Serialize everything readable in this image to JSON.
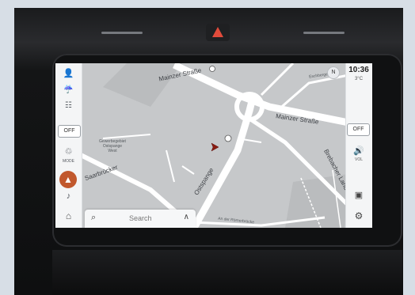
{
  "map": {
    "streets": {
      "mainzer_top": "Mainzer Straße",
      "mainzer_right": "Mainzer Straße",
      "ostspange": "Ostspange",
      "brebacher": "Brebacher Landstraße",
      "am_der_roemer": "An der Römerbrücke",
      "left_road": "Saarbrücker",
      "right_small": "Eschberger weg"
    },
    "poi_label": "Gewerbegebiet\nOstspange\nWest"
  },
  "left_bar": {
    "off_label": "OFF",
    "mode_label": "MODE"
  },
  "right_bar": {
    "time": "10:36",
    "temp": "3",
    "unit": "°C",
    "off_label": "OFF",
    "vol_label": "VOL"
  },
  "search": {
    "placeholder": "Search"
  },
  "compass": "N",
  "colors": {
    "map_bg": "#c2c4c6",
    "road": "#ffffff",
    "nav_button": "#c1582d",
    "hazard": "#e14b3b"
  }
}
